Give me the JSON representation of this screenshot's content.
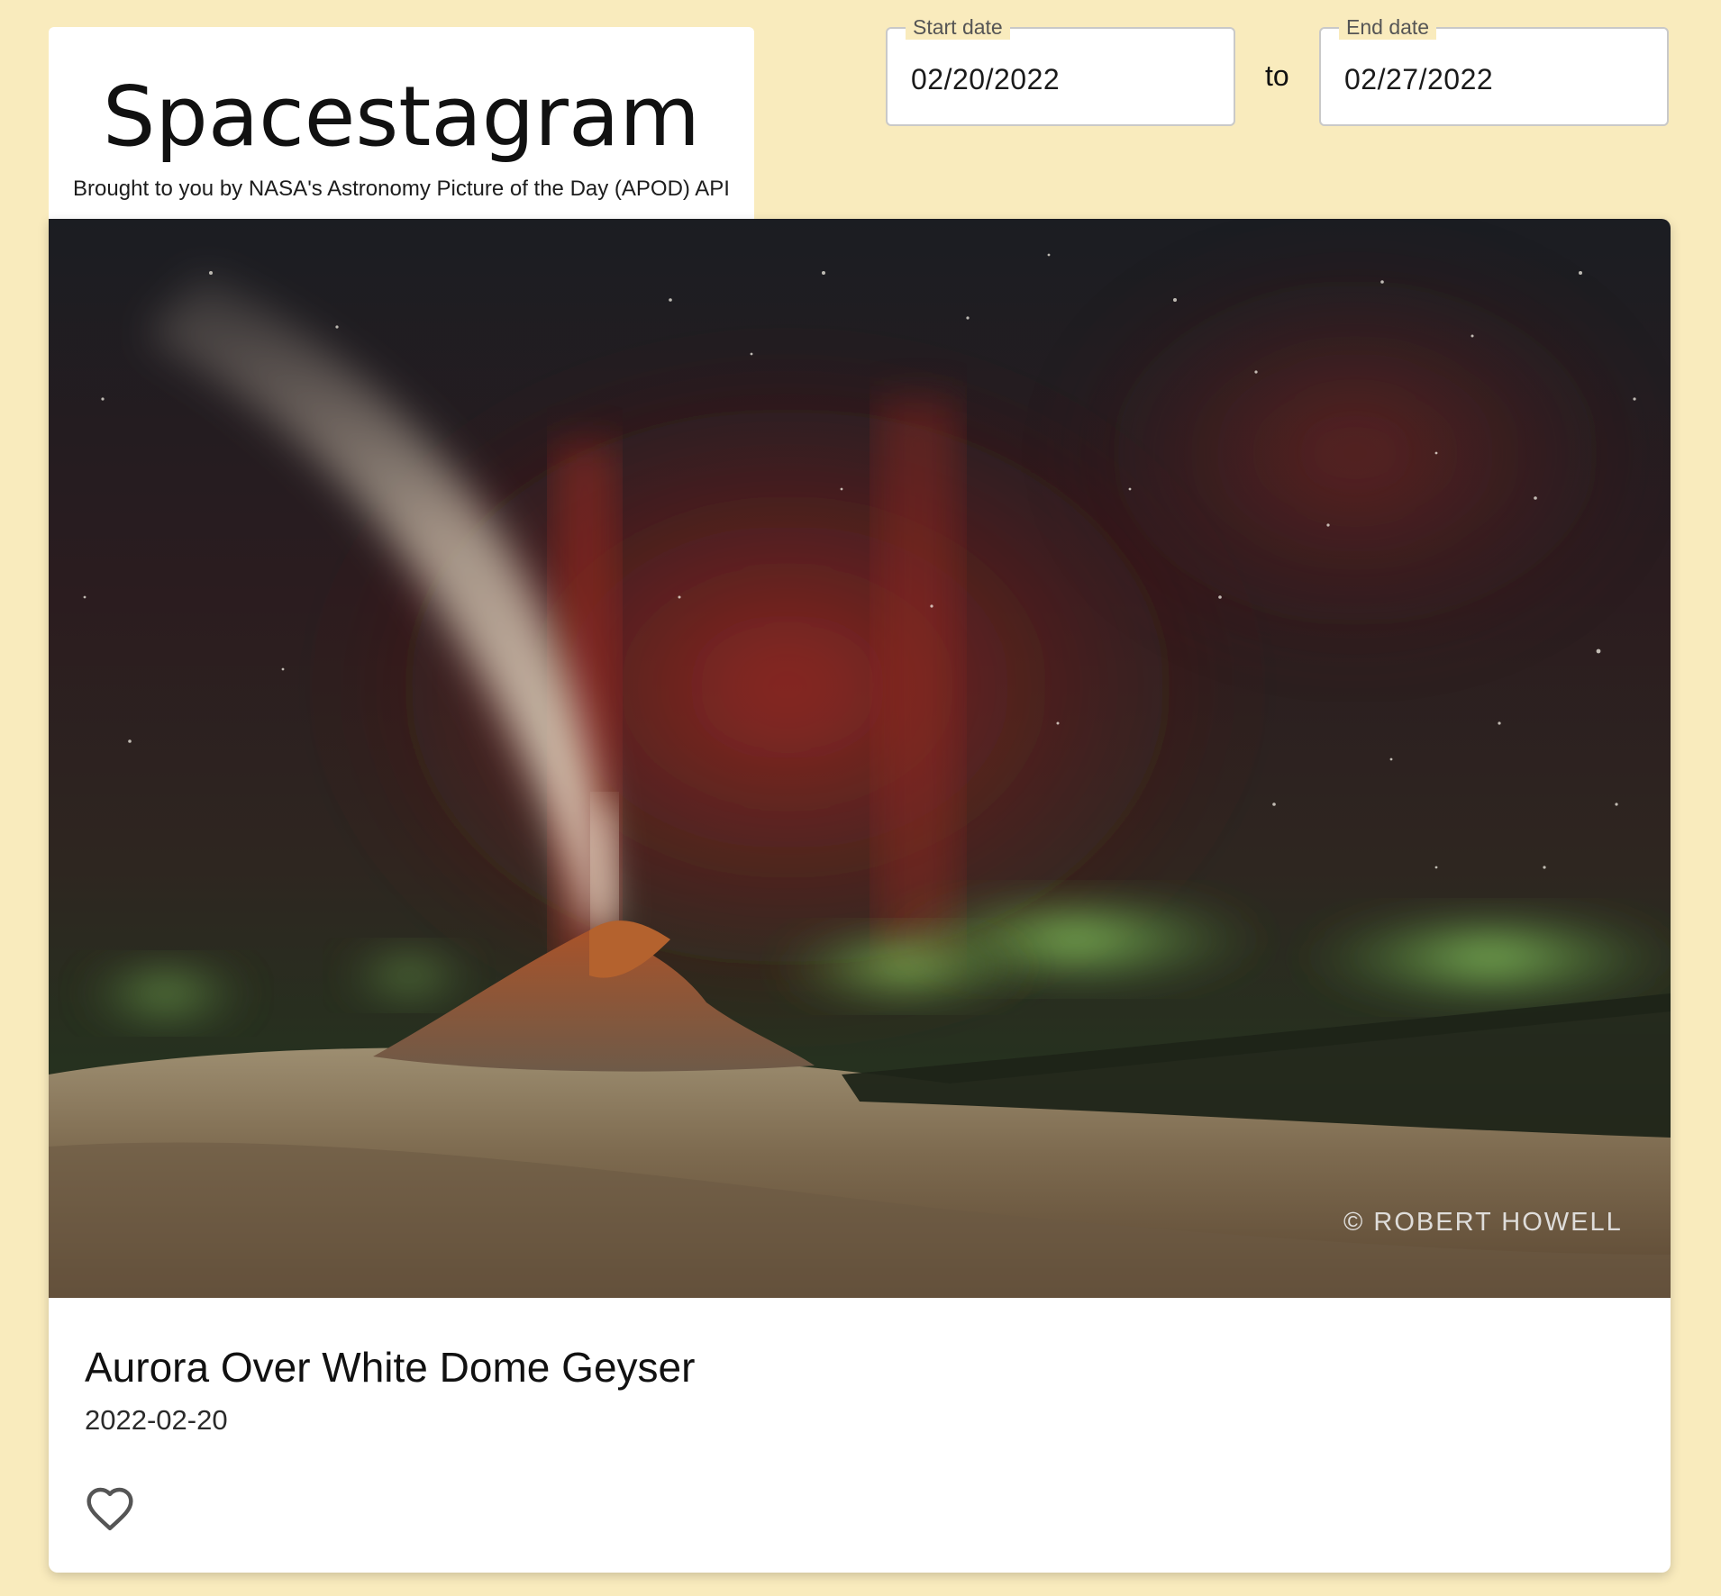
{
  "header": {
    "title": "Spacestagram",
    "subtitle": "Brought to you by NASA's Astronomy Picture of the Day (APOD) API"
  },
  "date_range": {
    "start": {
      "label": "Start date",
      "value": "02/20/2022"
    },
    "separator": "to",
    "end": {
      "label": "End date",
      "value": "02/27/2022"
    }
  },
  "post": {
    "title": "Aurora Over White Dome Geyser",
    "date": "2022-02-20",
    "watermark": "© ROBERT HOWELL",
    "liked": false,
    "like_icon": "heart-outline-icon"
  },
  "colors": {
    "background": "#f9ebbd",
    "card": "#ffffff"
  }
}
